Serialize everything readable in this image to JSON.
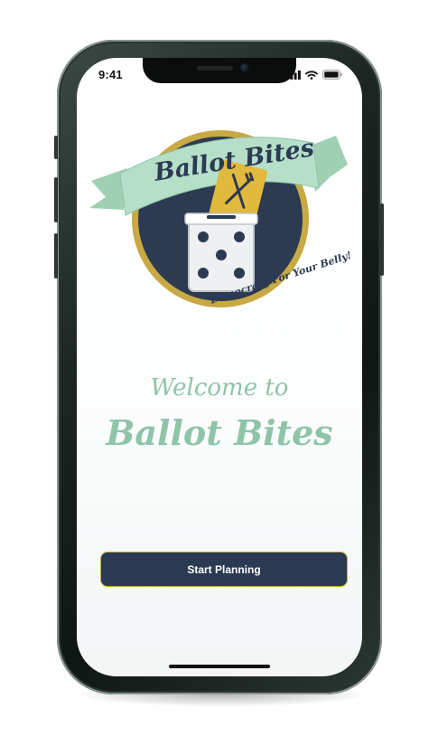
{
  "status_bar": {
    "time": "9:41",
    "icons": [
      "signal-icon",
      "wifi-icon",
      "battery-icon"
    ]
  },
  "logo": {
    "banner_text": "Ballot Bites",
    "tagline": "Democracy For Your Belly!",
    "ballot_icon": "fork-knife-icon",
    "box_icon": "ballot-box-dice-icon"
  },
  "welcome": {
    "line1": "Welcome to",
    "title": "Ballot Bites"
  },
  "actions": {
    "start_label": "Start Planning"
  },
  "colors": {
    "mint": "#8fc4a8",
    "navy": "#2a3a52",
    "gold": "#c8a944",
    "ballot_yellow": "#e1b93c"
  }
}
